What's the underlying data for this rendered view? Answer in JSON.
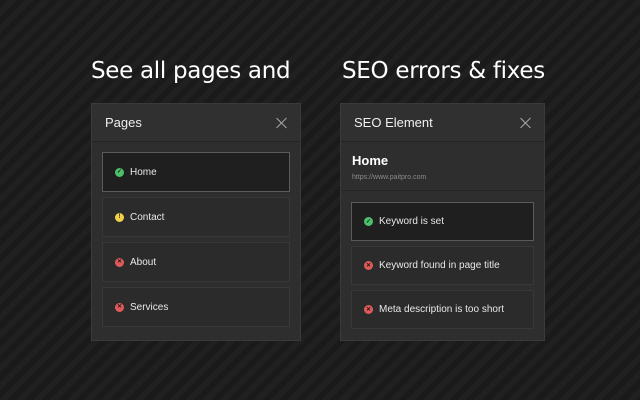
{
  "headlines": {
    "left": "See all pages and",
    "right": "SEO errors & fixes"
  },
  "pages_panel": {
    "title": "Pages",
    "items": [
      {
        "label": "Home",
        "status": "ok",
        "selected": true
      },
      {
        "label": "Contact",
        "status": "warn",
        "selected": false
      },
      {
        "label": "About",
        "status": "error",
        "selected": false
      },
      {
        "label": "Services",
        "status": "error",
        "selected": false
      }
    ]
  },
  "seo_panel": {
    "title": "SEO Element",
    "page_title": "Home",
    "page_url": "https://www.paitpro.com",
    "checks": [
      {
        "label": "Keyword is set",
        "status": "ok",
        "selected": true
      },
      {
        "label": "Keyword found in page title",
        "status": "error",
        "selected": false
      },
      {
        "label": "Meta description is too short",
        "status": "error",
        "selected": false
      }
    ]
  },
  "icons": {
    "ok": "check-circle-icon",
    "warn": "warning-circle-icon",
    "error": "x-circle-icon",
    "close": "close-icon"
  },
  "colors": {
    "ok": "#4cc06a",
    "warn": "#f0d04a",
    "error": "#e05a5a",
    "panel": "#2e2e2e",
    "background": "#1d1d1d"
  }
}
